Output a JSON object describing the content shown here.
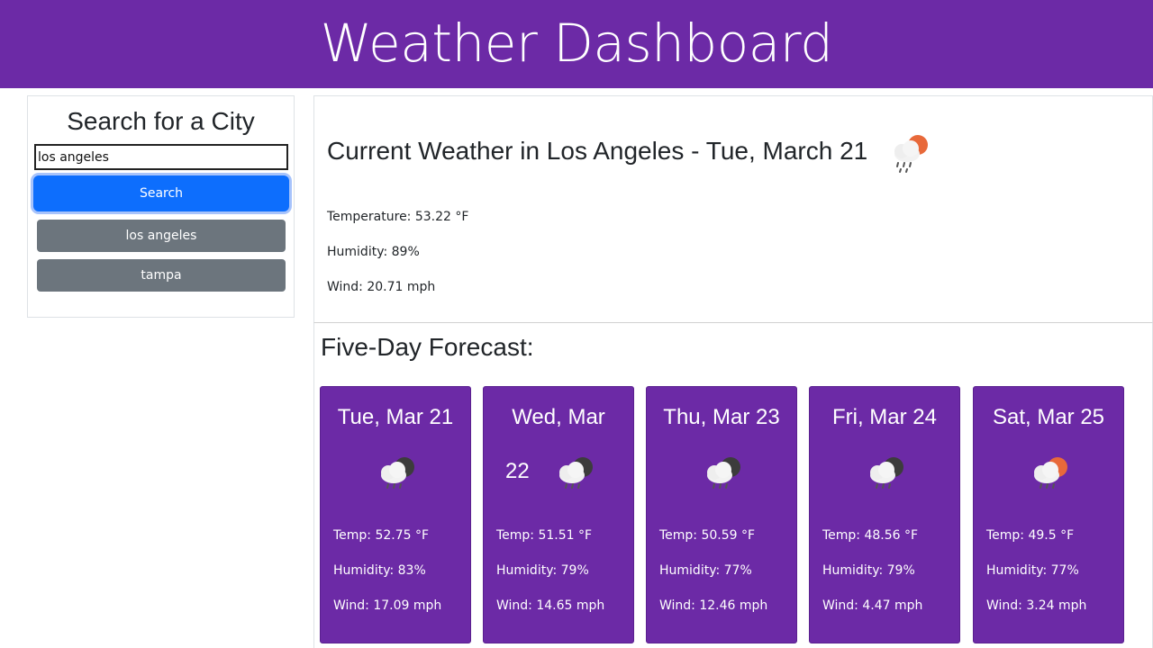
{
  "header": {
    "title": "Weather Dashboard"
  },
  "sidebar": {
    "heading": "Search for a City",
    "search_value": "los angeles",
    "search_button": "Search",
    "history": [
      "los angeles",
      "tampa"
    ]
  },
  "current": {
    "heading": "Current Weather in Los Angeles - Tue, March 21",
    "icon": "rain-sun-icon",
    "temperature": "Temperature: 53.22 °F",
    "humidity": "Humidity: 89%",
    "wind": "Wind: 20.71 mph"
  },
  "forecast": {
    "title": "Five-Day Forecast:",
    "days": [
      {
        "date": "Tue, Mar 21",
        "icon": "rain-moon-icon",
        "temp": "Temp: 52.75 °F",
        "humidity": "Humidity: 83%",
        "wind": "Wind: 17.09 mph"
      },
      {
        "date": "Wed, Mar",
        "date_line2": "22",
        "icon": "rain-moon-icon",
        "temp": "Temp: 51.51 °F",
        "humidity": "Humidity: 79%",
        "wind": "Wind: 14.65 mph"
      },
      {
        "date": "Thu, Mar 23",
        "icon": "rain-moon-icon",
        "temp": "Temp: 50.59 °F",
        "humidity": "Humidity: 77%",
        "wind": "Wind: 12.46 mph"
      },
      {
        "date": "Fri, Mar 24",
        "icon": "rain-moon-icon",
        "temp": "Temp: 48.56 °F",
        "humidity": "Humidity: 79%",
        "wind": "Wind: 4.47 mph"
      },
      {
        "date": "Sat, Mar 25",
        "icon": "rain-sun-icon",
        "temp": "Temp: 49.5 °F",
        "humidity": "Humidity: 77%",
        "wind": "Wind: 3.24 mph"
      }
    ]
  },
  "colors": {
    "brand": "#6c2aa6",
    "primary": "#0d6efd",
    "secondary": "#6c757d"
  }
}
